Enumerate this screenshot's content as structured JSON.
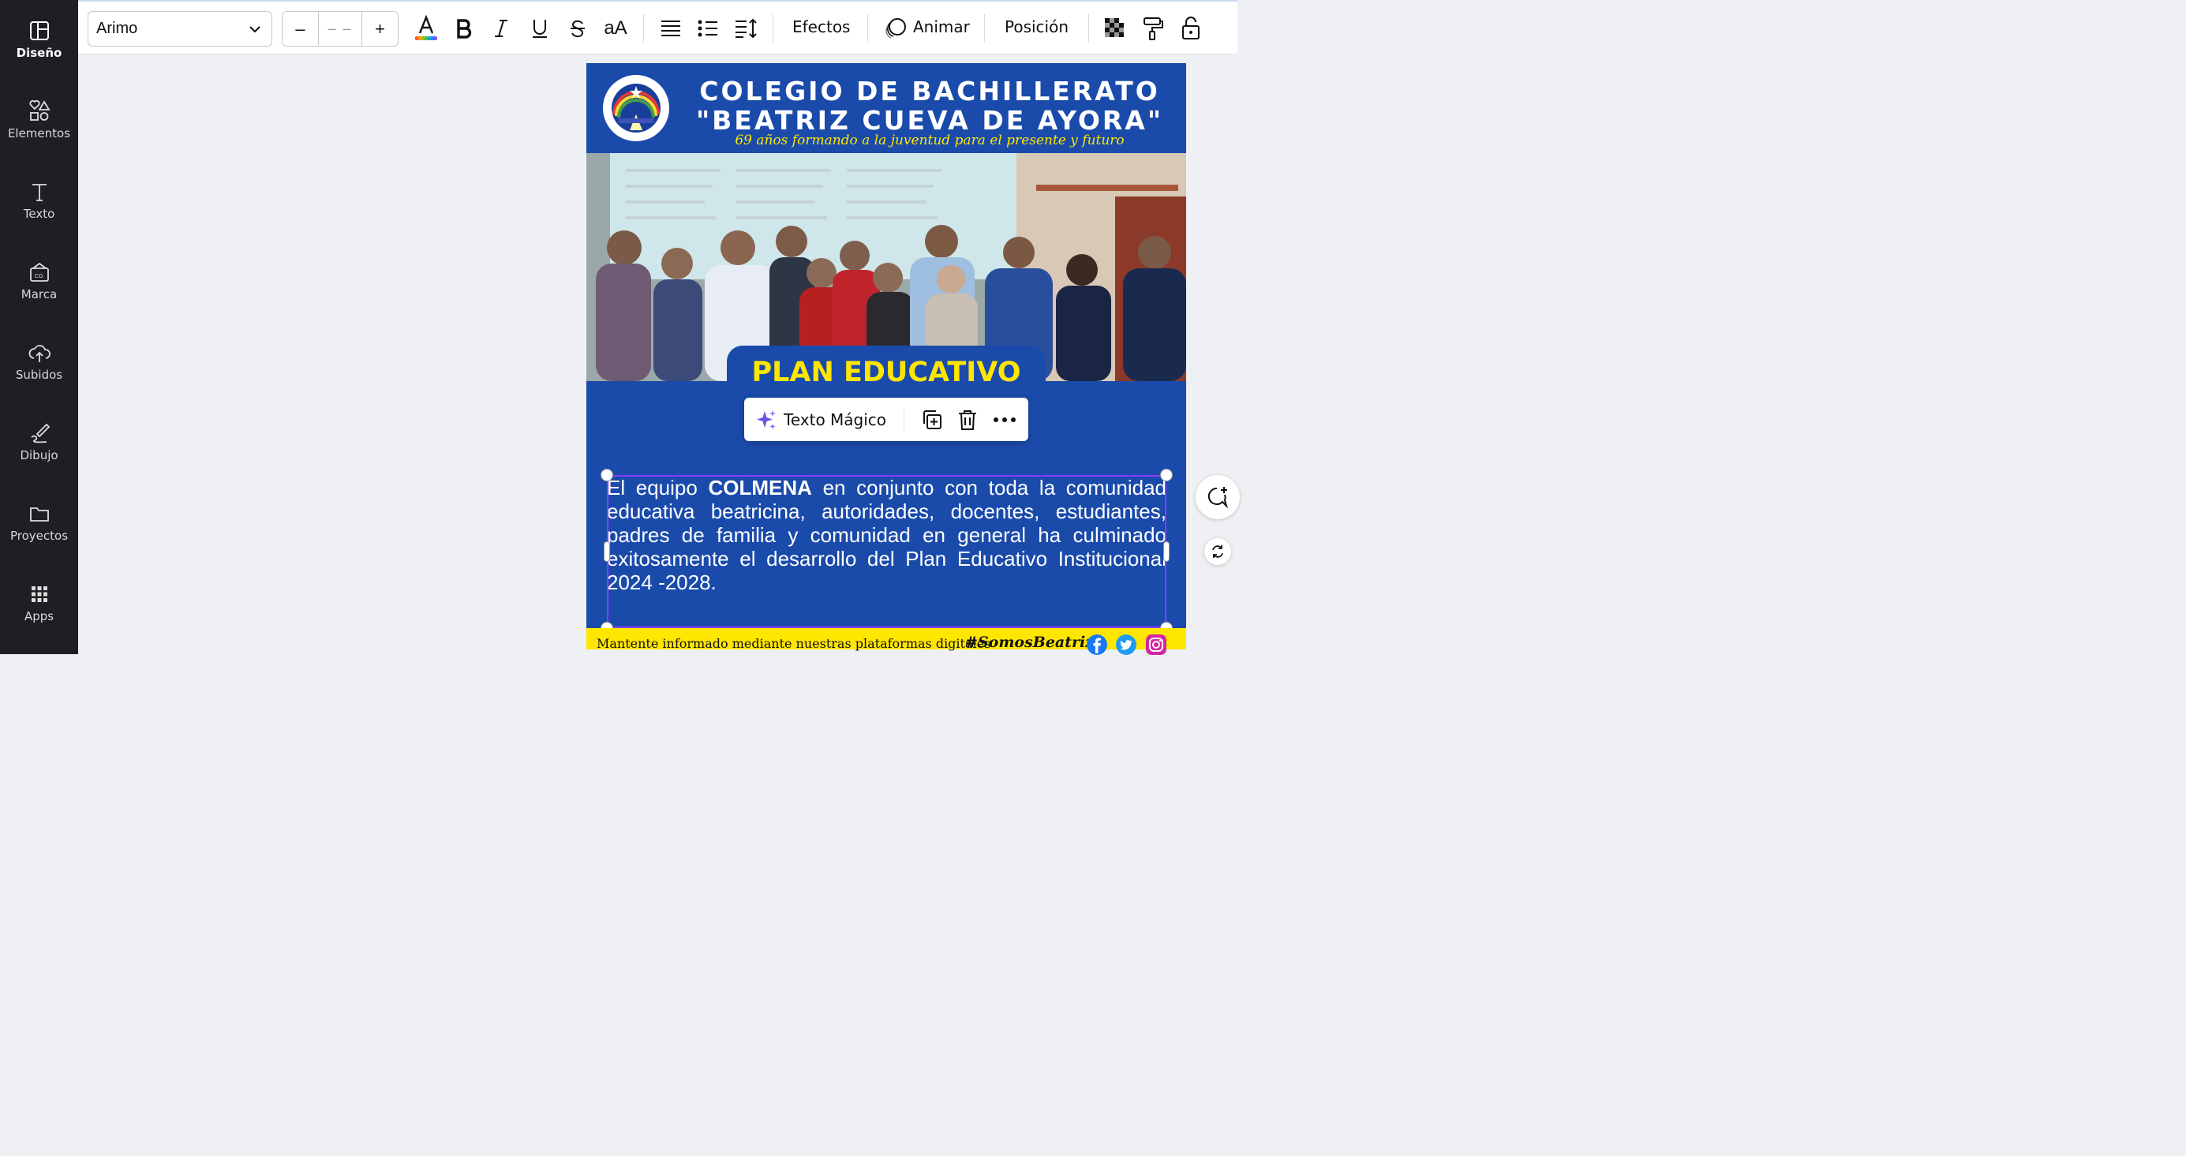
{
  "sidebar": {
    "items": [
      {
        "label": "Diseño",
        "icon": "layout-icon"
      },
      {
        "label": "Elementos",
        "icon": "shapes-icon"
      },
      {
        "label": "Texto",
        "icon": "text-icon"
      },
      {
        "label": "Marca",
        "icon": "brand-icon"
      },
      {
        "label": "Subidos",
        "icon": "upload-icon"
      },
      {
        "label": "Dibujo",
        "icon": "draw-icon"
      },
      {
        "label": "Proyectos",
        "icon": "folder-icon"
      },
      {
        "label": "Apps",
        "icon": "apps-icon"
      }
    ]
  },
  "toolbar": {
    "font": "Arimo",
    "size_minus": "–",
    "size_value": "– –",
    "size_plus": "+",
    "case_label": "aA",
    "effects_label": "Efectos",
    "animate_label": "Animar",
    "position_label": "Posición"
  },
  "design": {
    "title_line1": "COLEGIO DE BACHILLERATO",
    "title_line2": "\"BEATRIZ CUEVA DE AYORA\"",
    "motto": "69 años formando a la juventud para el presente y futuro",
    "plan_title": "PLAN EDUCATIVO",
    "body_before": "El equipo ",
    "body_bold": "COLMENA",
    "body_after": " en conjunto con toda la comunidad educativa beatricina, autoridades, docentes, estudiantes, padres de familia y comunidad en general ha culminado exitosamente el desarrollo del Plan Educativo Institucional 2024 -2028.",
    "footer_text": "Mantente informado mediante nuestras plataformas digitales",
    "hashtag": "#SomosBeatriz"
  },
  "magic_menu": {
    "label": "Texto Mágico"
  },
  "colors": {
    "design_blue": "#1a4bab",
    "accent_yellow": "#ffe600",
    "selection_purple": "#8b3dff",
    "sidebar_bg": "#1e1f24"
  }
}
